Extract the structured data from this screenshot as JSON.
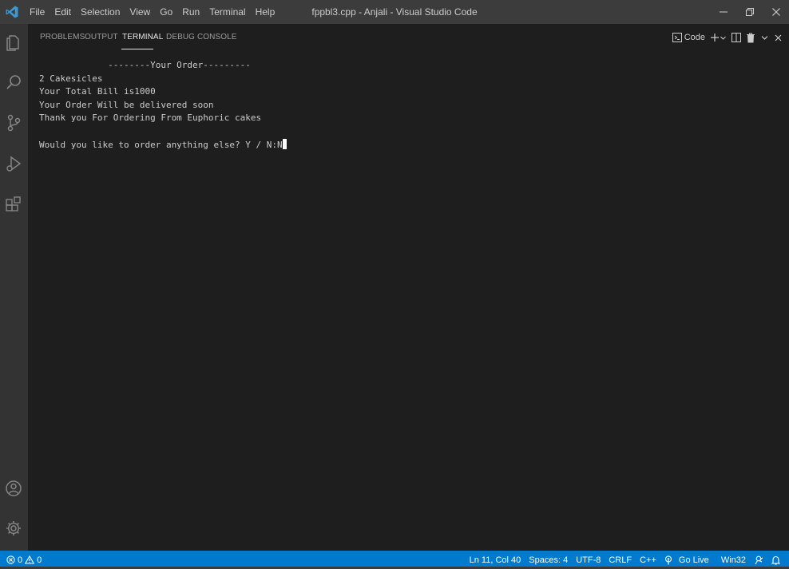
{
  "titlebar": {
    "menu": [
      "File",
      "Edit",
      "Selection",
      "View",
      "Go",
      "Run",
      "Terminal",
      "Help"
    ],
    "title": "fppbl3.cpp - Anjali - Visual Studio Code"
  },
  "panel": {
    "tabs": [
      "PROBLEMS",
      "OUTPUT",
      "TERMINAL",
      "DEBUG CONSOLE"
    ],
    "active_tab": "TERMINAL",
    "terminal_name": "Code"
  },
  "terminal": {
    "lines": [
      "             --------Your Order---------",
      "2 Cakesicles",
      "Your Total Bill is1000",
      "Your Order Will be delivered soon",
      "Thank you For Ordering From Euphoric cakes",
      "",
      "Would you like to order anything else? Y / N:N"
    ]
  },
  "statusbar": {
    "errors": "0",
    "warnings": "0",
    "cursor_position": "Ln 11, Col 40",
    "indentation": "Spaces: 4",
    "encoding": "UTF-8",
    "line_ending": "CRLF",
    "language": "C++",
    "go_live": "Go Live",
    "platform": "Win32"
  },
  "colors": {
    "accent": "#007acc",
    "titlebar": "#3c3c3c",
    "activitybar": "#333333",
    "editor_bg": "#1e1e1e",
    "vscode_blue": "#3c99d4"
  },
  "icons": [
    "vscode-logo-icon",
    "minimize-icon",
    "restore-icon",
    "close-icon",
    "explorer-icon",
    "search-icon",
    "source-control-icon",
    "run-debug-icon",
    "extensions-icon",
    "account-icon",
    "settings-gear-icon",
    "terminal-icon",
    "plus-icon",
    "chevron-down-icon",
    "split-icon",
    "trash-icon",
    "error-icon",
    "warning-icon",
    "broadcast-icon",
    "feedback-icon",
    "bell-icon"
  ]
}
